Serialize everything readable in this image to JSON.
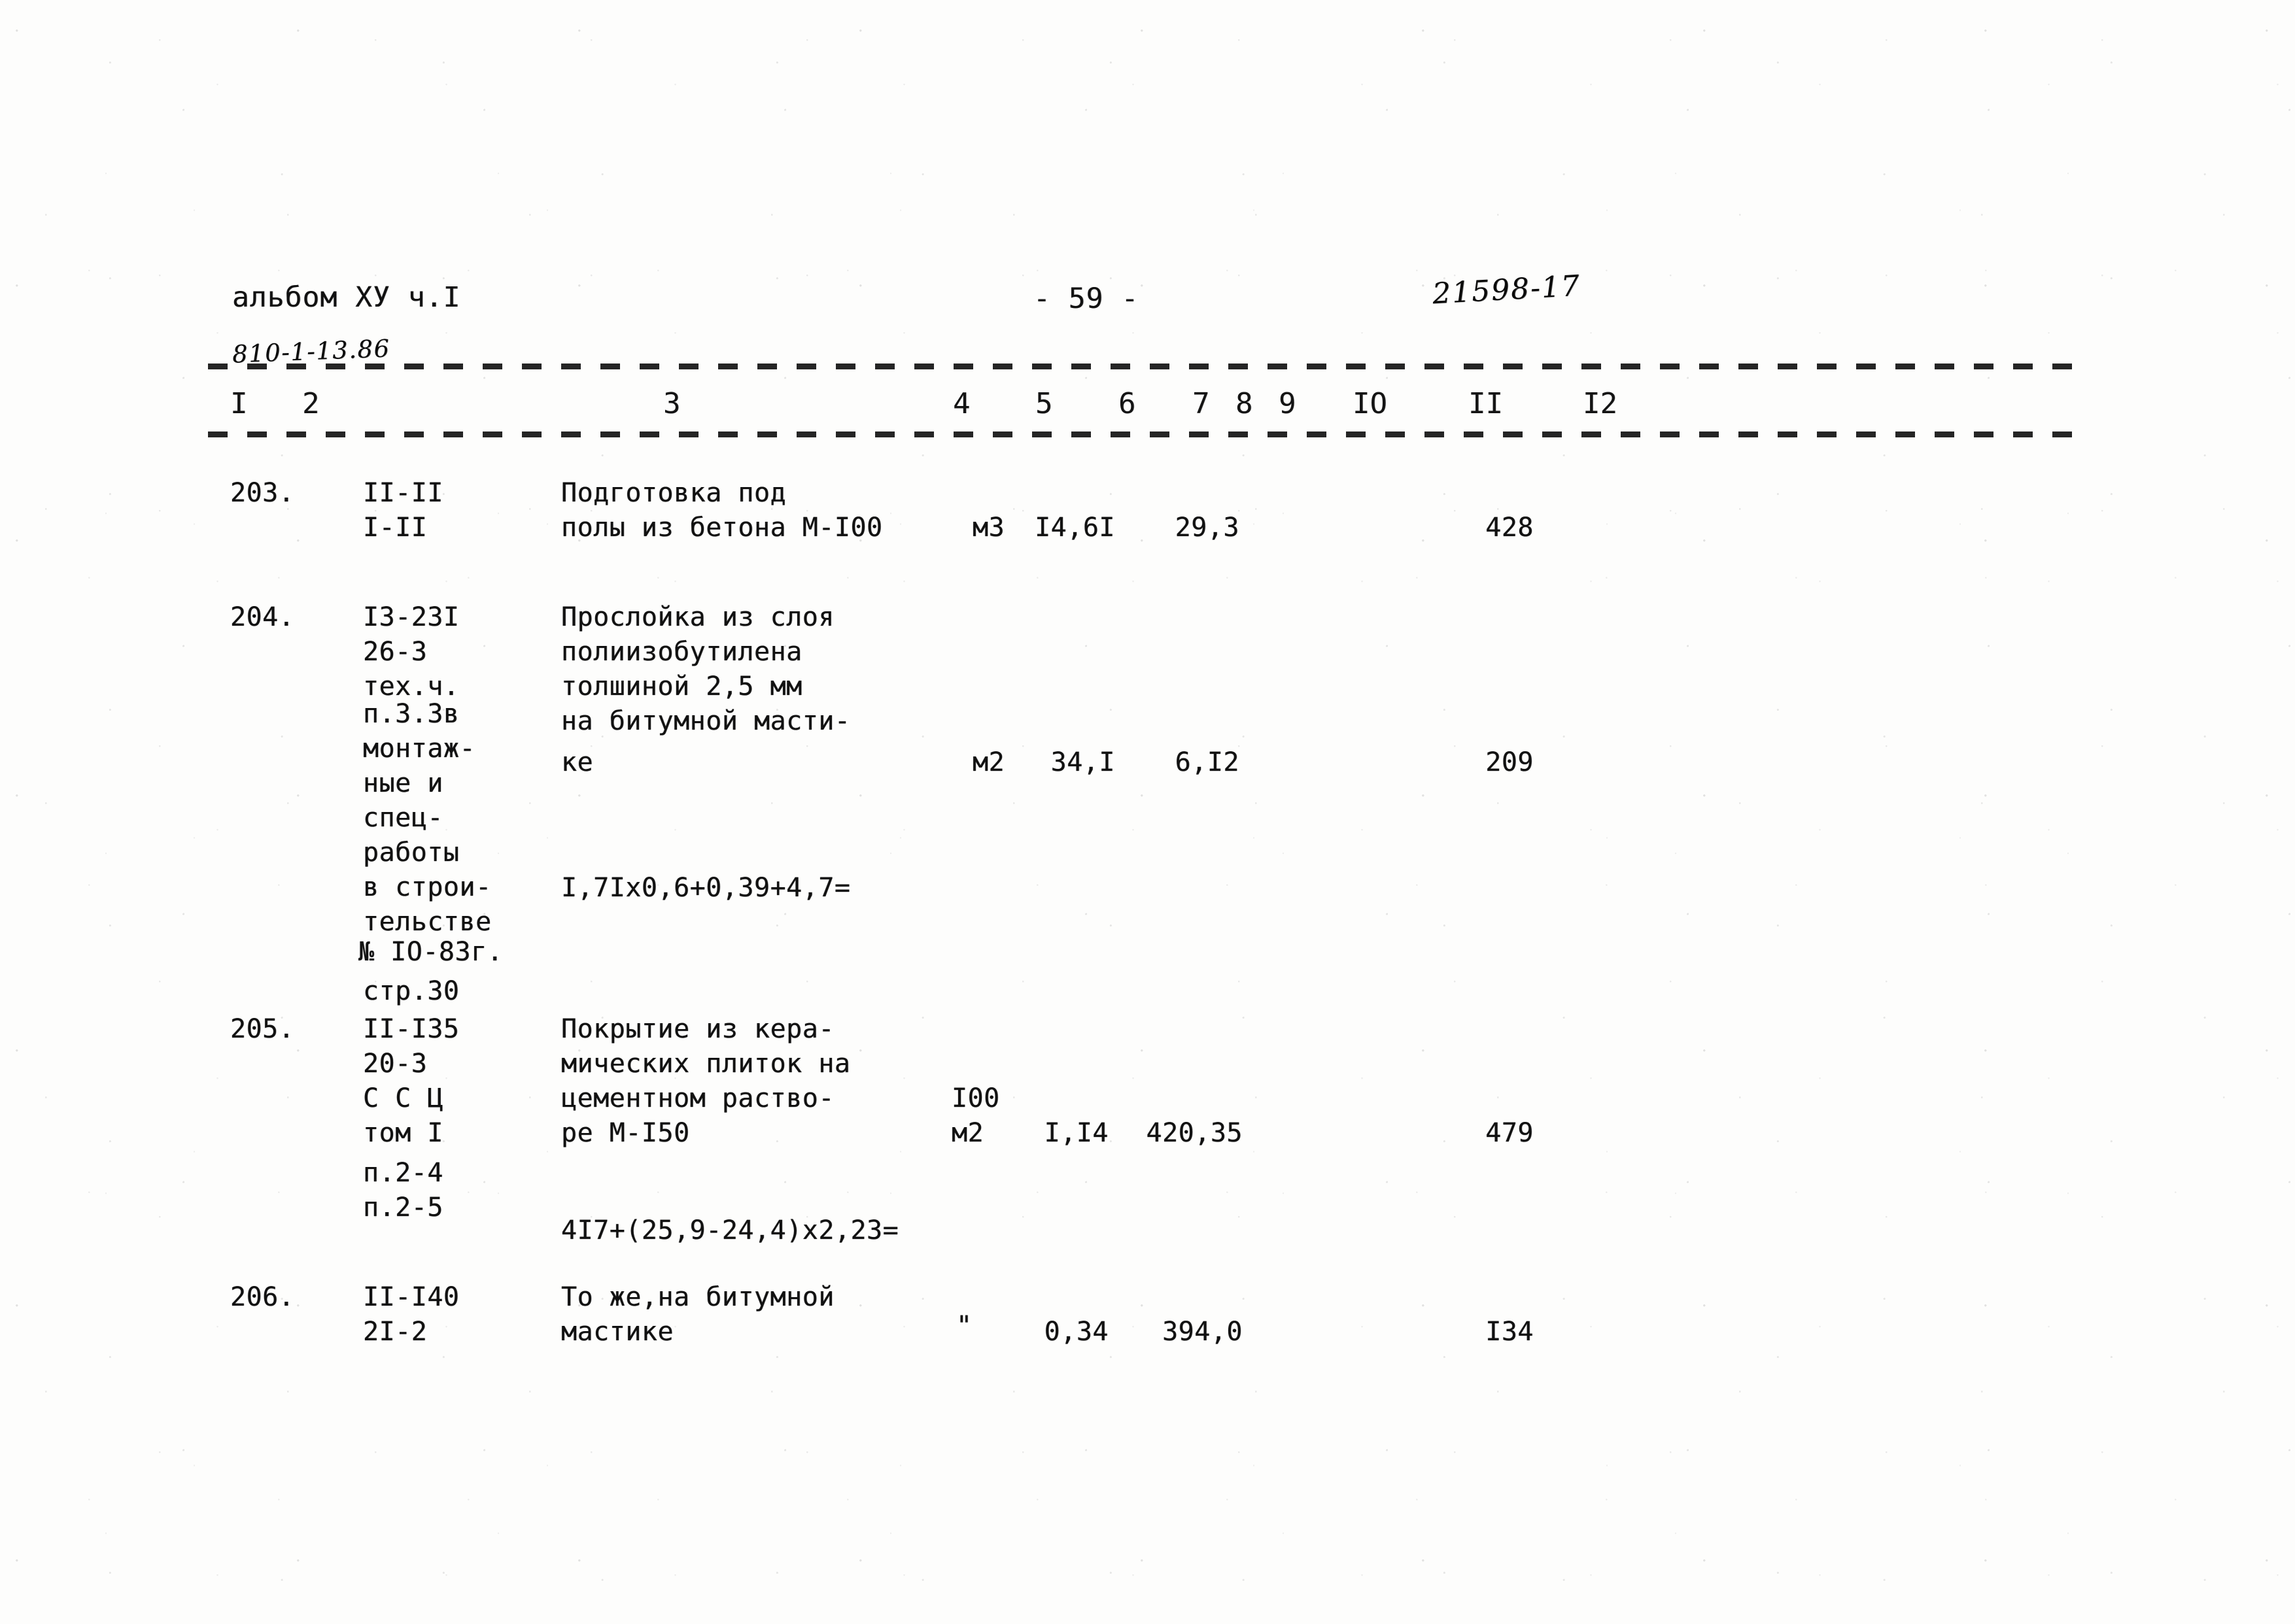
{
  "document": {
    "album_label": "альбом ХУ ч.I",
    "stamp_code": "810-1-13.86",
    "page_marker": "- 59 -",
    "archive_number": "21598-17"
  },
  "table": {
    "column_headers": [
      "I",
      "2",
      "3",
      "4",
      "5",
      "6",
      "7",
      "8",
      "9",
      "IO",
      "II",
      "I2"
    ],
    "rows": [
      {
        "no": "203.",
        "code_lines": [
          "II-II",
          "I-II"
        ],
        "description_lines": [
          "Подготовка под",
          "полы из бетона М-I00"
        ],
        "unit": "м3",
        "unit_extra": "",
        "quantity": "I4,6I",
        "price": "29,3",
        "total": "428",
        "formula": ""
      },
      {
        "no": "204.",
        "code_lines": [
          "I3-23I",
          "26-3",
          "тех.ч.",
          "п.3.3в",
          "монтаж-",
          "ные и",
          "спец-",
          "работы",
          "в строи-",
          "тельстве",
          "№ IO-83г.",
          "стр.30"
        ],
        "description_lines": [
          "Прослойка из слоя",
          "полиизобутилена",
          "толшиной 2,5 мм",
          "на битумной масти-",
          "ке"
        ],
        "unit": "м2",
        "unit_extra": "",
        "quantity": "34,I",
        "price": "6,I2",
        "total": "209",
        "formula": "I,7Iх0,6+0,39+4,7="
      },
      {
        "no": "205.",
        "code_lines": [
          "II-I35",
          "20-3",
          "С С Ц",
          "том I",
          "п.2-4",
          "п.2-5"
        ],
        "description_lines": [
          "Покрытие из кера-",
          "мических плиток на",
          "цементном раство-",
          "ре М-I50"
        ],
        "unit": "м2",
        "unit_extra": "I00",
        "quantity": "I,I4",
        "price": "420,35",
        "total": "479",
        "formula": "4I7+(25,9-24,4)х2,23="
      },
      {
        "no": "206.",
        "code_lines": [
          "II-I40",
          "2I-2"
        ],
        "description_lines": [
          "То же,на битумной",
          "мастике"
        ],
        "unit": "\"",
        "unit_extra": "",
        "quantity": "0,34",
        "price": "394,0",
        "total": "I34",
        "formula": ""
      }
    ]
  }
}
